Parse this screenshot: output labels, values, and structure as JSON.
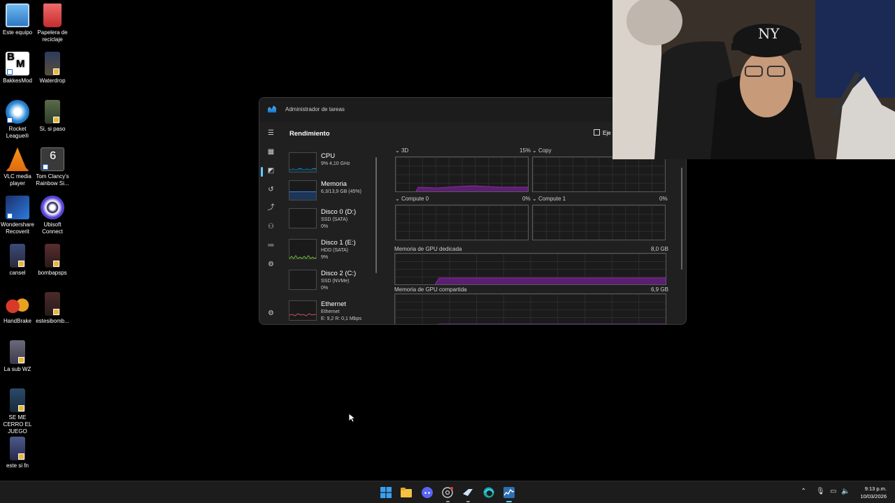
{
  "desktop": {
    "icons": [
      {
        "label": "Este equipo"
      },
      {
        "label": "Papelera de reciclaje"
      },
      {
        "label": "BakkesMod"
      },
      {
        "label": "Waterdrop"
      },
      {
        "label": "Rocket League®"
      },
      {
        "label": "Si, si paso"
      },
      {
        "label": "VLC media player"
      },
      {
        "label": "Tom Clancy's Rainbow Si..."
      },
      {
        "label": "Wondershare Recoverit"
      },
      {
        "label": "Ubisoft Connect"
      },
      {
        "label": "cansel"
      },
      {
        "label": "bombapsps"
      },
      {
        "label": "HandBrake"
      },
      {
        "label": "estesibomb..."
      },
      {
        "label": "La sub WZ"
      },
      {
        "label": "SE ME CERRO EL JUEGO"
      },
      {
        "label": "este si fn"
      }
    ]
  },
  "task_manager": {
    "title": "Administrador de tareas",
    "page_header": "Rendimiento",
    "run_task_label": "Eje",
    "nav_icons": [
      "hamburger-icon",
      "processes-icon",
      "performance-icon",
      "history-icon",
      "startup-icon",
      "users-icon",
      "details-icon",
      "services-icon",
      "settings-icon"
    ],
    "side_items": [
      {
        "name": "CPU",
        "sub1": "9% 4,10 GHz",
        "sub2": "",
        "color": "#2f8fc6"
      },
      {
        "name": "Memoria",
        "sub1": "6,3/13,9 GB (45%)",
        "sub2": "",
        "color": "#3f7fd4"
      },
      {
        "name": "Disco 0 (D:)",
        "sub1": "SSD (SATA)",
        "sub2": "0%",
        "color": "#5aa02c"
      },
      {
        "name": "Disco 1 (E:)",
        "sub1": "HDD (SATA)",
        "sub2": "9%",
        "color": "#6bbf2f"
      },
      {
        "name": "Disco 2 (C:)",
        "sub1": "SSD (NVMe)",
        "sub2": "0%",
        "color": "#5aa02c"
      },
      {
        "name": "Ethernet",
        "sub1": "Ethernet",
        "sub2": "E: 9,2 R: 0,1 Mbps",
        "color": "#c7505a"
      }
    ],
    "gpu": {
      "engine_3d": {
        "label": "3D",
        "value": "15%"
      },
      "copy": {
        "label": "Copy",
        "value": ""
      },
      "compute0": {
        "label": "Compute 0",
        "value": "0%"
      },
      "compute1": {
        "label": "Compute 1",
        "value": "0%"
      },
      "dedicated": {
        "label": "Memoria de GPU dedicada",
        "value": "8,0 GB"
      },
      "shared": {
        "label": "Memoria de GPU compartida",
        "value": "6,9 GB"
      }
    },
    "accent_purple": "#8b2ca8"
  },
  "taskbar": {
    "apps": [
      "windows-start-icon",
      "file-explorer-icon",
      "discord-icon",
      "chrome-icon",
      "steam-icon",
      "edge-icon",
      "task-manager-icon"
    ],
    "time": "9:13 p.m.",
    "date": "10/03/2026"
  }
}
